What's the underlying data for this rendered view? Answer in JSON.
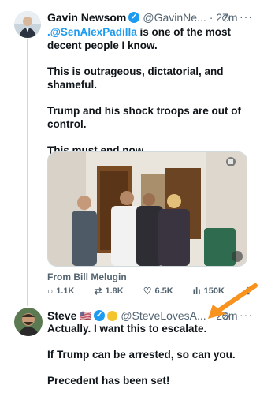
{
  "tweet1": {
    "name": "Gavin Newsom",
    "handle": "@GavinNe...",
    "time": "· 27m",
    "mention": ".@SenAlexPadilla",
    "line1_rest": " is one of the most decent people I know.",
    "para2": "This is outrageous, dictatorial, and shameful.",
    "para3": "Trump and his shock troops are out of control.",
    "para4": "This must end now.",
    "from": "From Bill Melugin",
    "replies": "1.1K",
    "reposts": "1.8K",
    "likes": "6.5K",
    "views": "150K"
  },
  "tweet2": {
    "name": "Steve",
    "flag": "🇺🇸",
    "handle": "@SteveLovesA...",
    "time": "· 25m",
    "para1": "Actually. I want this to escalate.",
    "para2": "If Trump can be arrested, so can you.",
    "para3": "Precedent has been set!"
  },
  "colors": {
    "accent": "#1d9bf0",
    "arrow": "#f7931e",
    "muted": "#536471"
  }
}
